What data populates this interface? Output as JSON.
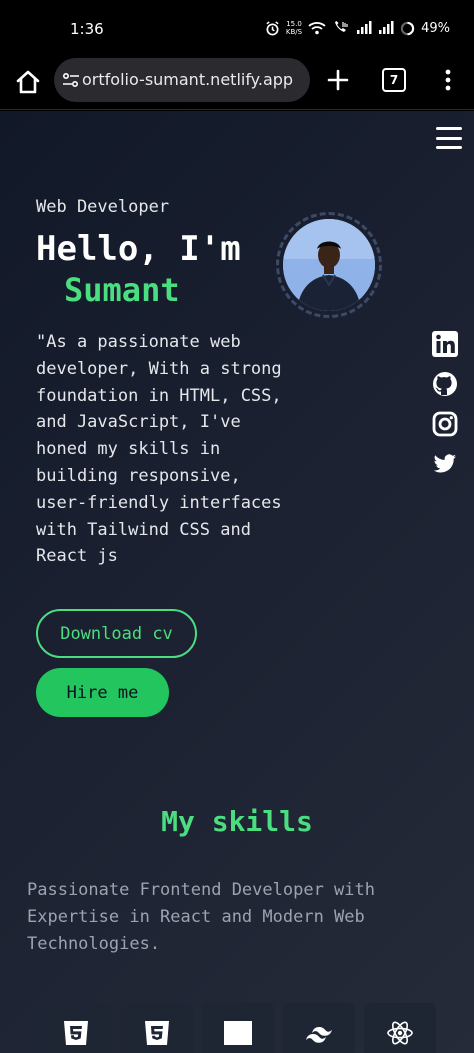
{
  "status_bar": {
    "time": "1:36",
    "net_speed_value": "15.0",
    "net_speed_unit": "KB/S",
    "battery": "49%"
  },
  "browser": {
    "url": "ortfolio-sumant.netlify.app",
    "tab_count": "7"
  },
  "hero": {
    "role": "Web Developer",
    "greeting": "Hello, I'm",
    "name": "Sumant",
    "bio": "\"As a passionate web developer, With a strong foundation in HTML, CSS, and JavaScript, I've honed my skills in building responsive, user-friendly interfaces with Tailwind CSS and React js",
    "download_cv_label": "Download cv",
    "hire_me_label": "Hire me"
  },
  "socials": [
    {
      "icon": "linkedin-icon"
    },
    {
      "icon": "github-icon"
    },
    {
      "icon": "instagram-icon"
    },
    {
      "icon": "twitter-icon"
    }
  ],
  "skills": {
    "title": "My skills",
    "description": "Passionate Frontend Developer with Expertise in React and Modern Web Technologies.",
    "cards": [
      {
        "icon": "html5-icon"
      },
      {
        "icon": "css3-icon"
      },
      {
        "icon": "javascript-icon"
      },
      {
        "icon": "tailwind-icon"
      },
      {
        "icon": "react-icon"
      }
    ]
  },
  "colors": {
    "accent_green": "#4ade80",
    "button_green": "#22c55e",
    "page_bg": "#111827"
  }
}
